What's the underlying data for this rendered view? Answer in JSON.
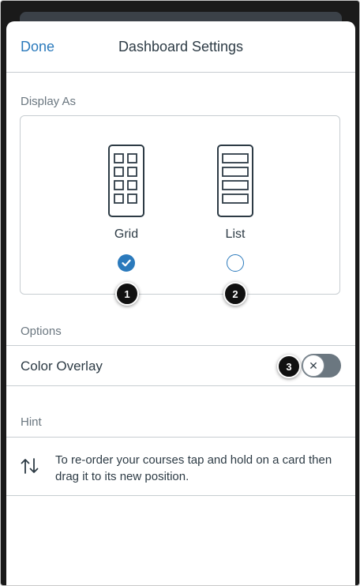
{
  "header": {
    "done_label": "Done",
    "title": "Dashboard Settings"
  },
  "display_as": {
    "section_label": "Display As",
    "options": [
      {
        "label": "Grid",
        "selected": true,
        "icon": "grid-layout-icon",
        "callout": "1"
      },
      {
        "label": "List",
        "selected": false,
        "icon": "list-layout-icon",
        "callout": "2"
      }
    ]
  },
  "options": {
    "section_label": "Options",
    "color_overlay": {
      "label": "Color Overlay",
      "enabled": false,
      "callout": "3"
    }
  },
  "hint": {
    "section_label": "Hint",
    "icon": "reorder-arrows-icon",
    "text": "To re-order your courses tap and hold on a card then drag it to its new position."
  },
  "colors": {
    "accent": "#2b7abc",
    "text": "#2d3b45",
    "muted": "#6b7780",
    "divider": "#c7cdd1"
  }
}
